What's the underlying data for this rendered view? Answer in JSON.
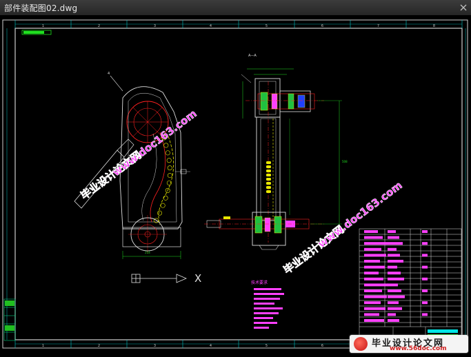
{
  "window": {
    "title": "部件装配图02.dwg"
  },
  "drawing": {
    "column_numbers": [
      "1",
      "2",
      "3",
      "4",
      "5",
      "6",
      "7",
      "8"
    ],
    "section_label": "A—A",
    "axis_x_label": "X",
    "notes_title": "技术要求",
    "colors": {
      "frame": "#ffffff",
      "grid": "#00e5e5",
      "part": "#ff2020",
      "dim": "#20e020",
      "note": "#ff40ff",
      "yellow": "#e8e800"
    }
  },
  "watermark": {
    "text_cn": "毕业设计论文网",
    "text_url": "www.doc163.com",
    "brand_cn": "毕业设计论文网",
    "brand_url": "www.56doc.com"
  }
}
